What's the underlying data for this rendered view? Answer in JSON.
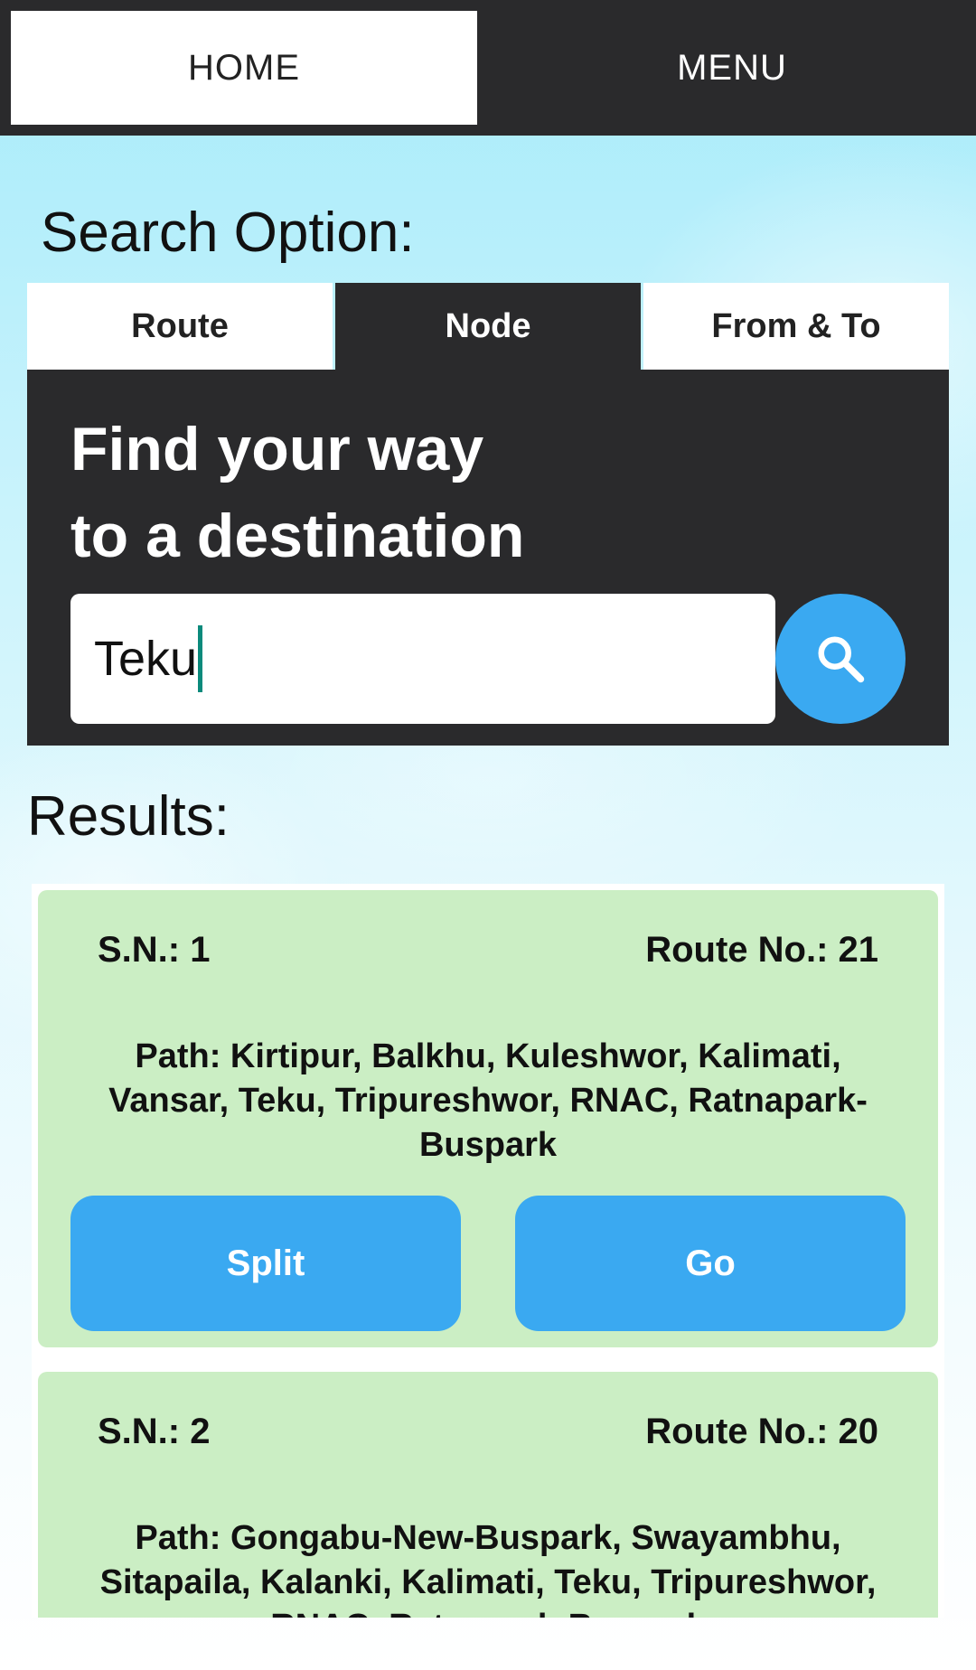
{
  "topbar": {
    "home_label": "HOME",
    "menu_label": "MENU"
  },
  "search": {
    "section_label": "Search Option:",
    "tabs": [
      {
        "label": "Route"
      },
      {
        "label": "Node",
        "active": true
      },
      {
        "label": "From & To"
      }
    ],
    "panel_title_line1": "Find your way",
    "panel_title_line2": "to a destination",
    "input_value": "Teku",
    "search_icon": "search-icon"
  },
  "results": {
    "section_label": "Results:",
    "items": [
      {
        "sn": "S.N.: 1",
        "route_no": "Route No.: 21",
        "path": "Path: Kirtipur, Balkhu, Kuleshwor, Kalimati, Vansar, Teku, Tripureshwor, RNAC, Ratnapark-Buspark",
        "split_label": "Split",
        "go_label": "Go"
      },
      {
        "sn": "S.N.: 2",
        "route_no": "Route No.: 20",
        "path": "Path: Gongabu-New-Buspark, Swayambhu, Sitapaila, Kalanki, Kalimati, Teku, Tripureshwor, RNAC, Ratnapark-Buspark"
      }
    ]
  },
  "colors": {
    "dark": "#2a2a2c",
    "accent_blue": "#3aa9f1",
    "card_green": "#cbeec4",
    "caret": "#0b8a7c"
  }
}
